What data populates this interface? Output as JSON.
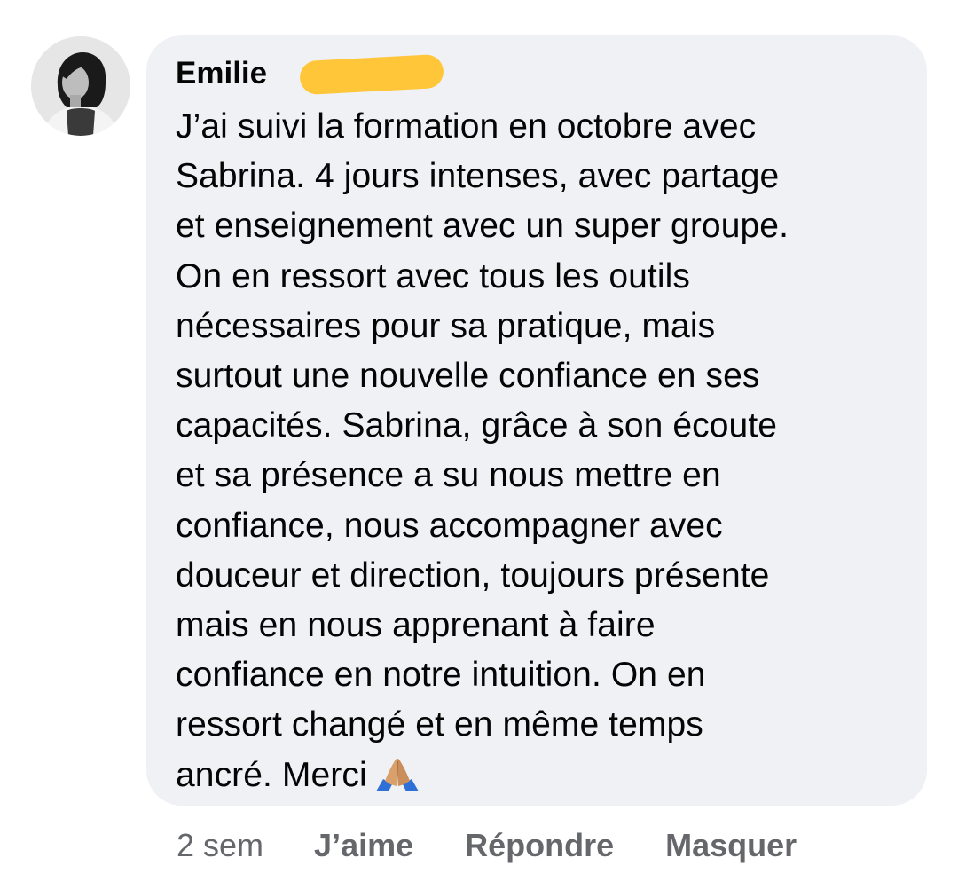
{
  "comment": {
    "author": "Emilie",
    "text_lines": [
      "J’ai suivi la formation en octobre avec",
      "Sabrina. 4 jours intenses, avec partage",
      "et enseignement avec un super groupe.",
      "On en ressort avec tous les outils",
      "nécessaires pour sa pratique, mais",
      "surtout une nouvelle confiance en ses",
      "capacités. Sabrina, grâce à son écoute",
      "et sa présence a su nous mettre en",
      "confiance, nous accompagner avec",
      "douceur et direction, toujours présente",
      "mais en nous apprenant à faire",
      "confiance en notre intuition. On en",
      "ressort changé et en même temps",
      "ancré. Merci"
    ],
    "emoji_icon": "folded-hands-icon"
  },
  "actions": {
    "timestamp": "2 sem",
    "like_label": "J’aime",
    "reply_label": "Répondre",
    "hide_label": "Masquer"
  },
  "colors": {
    "bubble_bg": "#eff1f5",
    "text": "#050505",
    "muted": "#65676b",
    "redaction": "#ffc63a"
  }
}
